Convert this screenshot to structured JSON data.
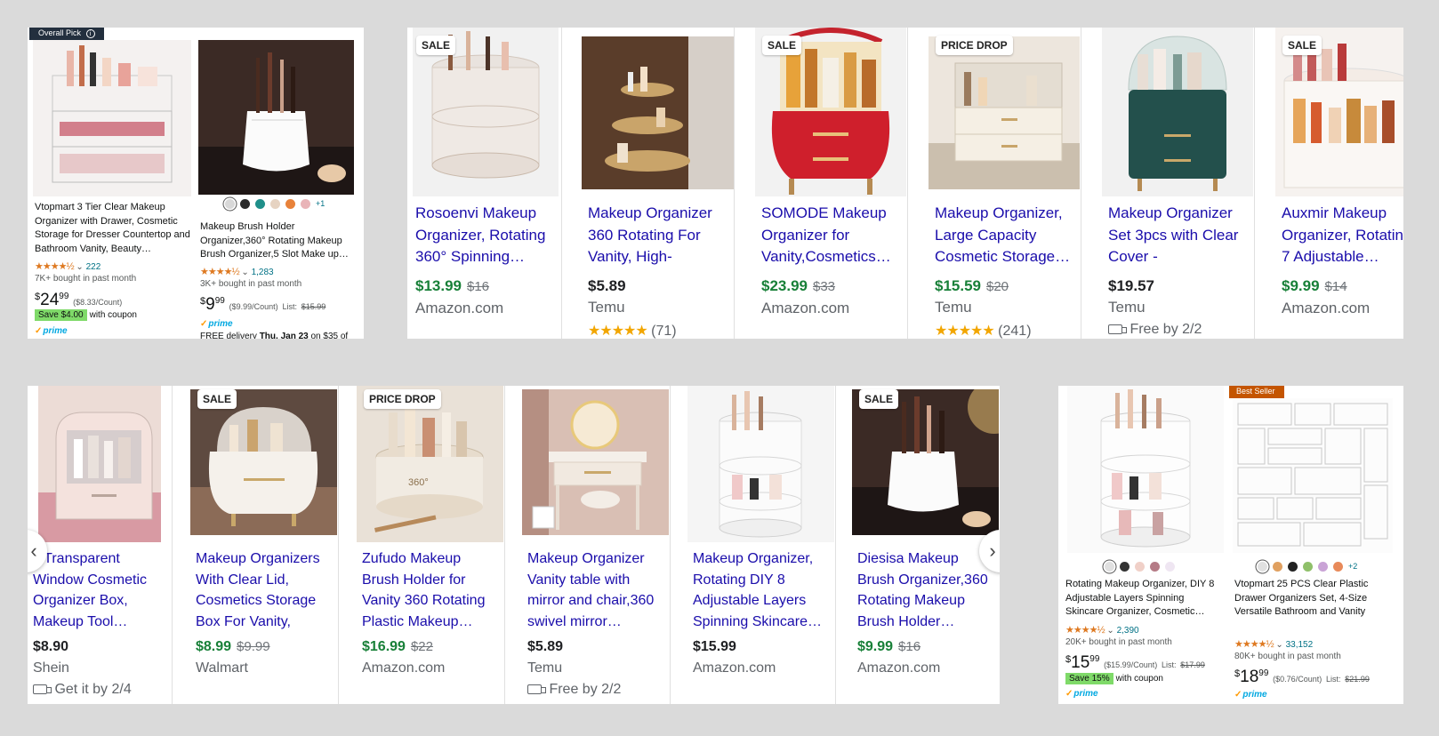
{
  "top_left_amazon": {
    "items": [
      {
        "ribbon": "Overall Pick",
        "info_icon": "i",
        "title": "Vtopmart 3 Tier Clear Makeup Organizer with Drawer, Cosmetic Storage for Dresser Countertop and Bathroom Vanity, Beauty…",
        "rating_count": "222",
        "bought": "7K+ bought in past month",
        "price_symbol": "$",
        "price_whole": "24",
        "price_frac": "99",
        "unit": "($8.33/Count)",
        "coupon_tag": "Save $4.00",
        "coupon_text": "with coupon",
        "prime": "prime"
      },
      {
        "title": "Makeup Brush Holder Organizer,360° Rotating Makeup Brush Organizer,5 Slot Make up…",
        "rating_count": "1,283",
        "bought": "3K+ bought in past month",
        "price_symbol": "$",
        "price_whole": "9",
        "price_frac": "99",
        "unit": "($9.99/Count)",
        "list_label": "List:",
        "list_price": "$15.99",
        "prime": "prime",
        "delivery_prefix": "FREE delivery",
        "delivery_date": "Thu, Jan 23",
        "delivery_suffix": "on $35 of",
        "more_swatches": "+1",
        "swatch_colors": [
          "#d8d8d8",
          "#2b2b2b",
          "#1f8f8a",
          "#e6d3c2",
          "#e8823a",
          "#e9b4b8"
        ]
      }
    ]
  },
  "top_google": {
    "items": [
      {
        "badge": "SALE",
        "title": "Rosoenvi Makeup Organizer, Rotating 360° Spinning…",
        "price": "$13.99",
        "old_price": "$16",
        "merchant": "Amazon.com"
      },
      {
        "badge": "",
        "title": "Makeup Organizer 360 Rotating For Vanity, High-Capaci…",
        "price": "$5.89",
        "merchant": "Temu",
        "stars": "★★★★★",
        "reviews": "(71)"
      },
      {
        "badge": "SALE",
        "title": "SOMODE Makeup Organizer for Vanity,Cosmetics…",
        "price": "$23.99",
        "old_price": "$33",
        "merchant": "Amazon.com"
      },
      {
        "badge": "PRICE DROP",
        "title": "Makeup Organizer, Large Capacity Cosmetic Storage…",
        "price": "$15.59",
        "old_price": "$20",
        "merchant": "Temu",
        "stars": "★★★★★",
        "reviews": "(241)"
      },
      {
        "badge": "",
        "title": "Makeup Organizer Set 3pcs with Clear Cover - Waterproof…",
        "price": "$19.57",
        "merchant": "Temu",
        "shipping": "Free by 2/2"
      },
      {
        "badge": "SALE",
        "title": "Auxmir Makeup Organizer, Rotating DIY 7 Adjustable…",
        "price": "$9.99",
        "old_price": "$14",
        "merchant": "Amazon.com"
      }
    ]
  },
  "bottom_google": {
    "prev_icon": "‹",
    "next_icon": "›",
    "items": [
      {
        "badge": "",
        "title": "c Transparent Window Cosmetic Organizer Box, Makeup Tool…",
        "price": "$8.90",
        "merchant": "Shein",
        "shipping": "Get it by 2/4"
      },
      {
        "badge": "SALE",
        "title": "Makeup Organizers With Clear Lid, Cosmetics Storage Box For Vanity, Mak…",
        "price": "$8.99",
        "old_price": "$9.99",
        "merchant": "Walmart"
      },
      {
        "badge": "PRICE DROP",
        "title": "Zufudo Makeup Brush Holder for Vanity 360 Rotating Plastic Makeup…",
        "price": "$16.99",
        "old_price": "$22",
        "merchant": "Amazon.com"
      },
      {
        "badge": "",
        "title": "Makeup Organizer Vanity table with mirror and chair,360 swivel mirror…",
        "price": "$5.89",
        "merchant": "Temu",
        "shipping": "Free by 2/2"
      },
      {
        "badge": "",
        "title": "Makeup Organizer, Rotating DIY 8 Adjustable Layers Spinning Skincare…",
        "price": "$15.99",
        "merchant": "Amazon.com"
      },
      {
        "badge": "SALE",
        "title": "Diesisa Makeup Brush Organizer,360 Rotating Makeup Brush Holder…",
        "price": "$9.99",
        "old_price": "$16",
        "merchant": "Amazon.com"
      }
    ]
  },
  "bottom_right_amazon": {
    "items": [
      {
        "title": "Rotating Makeup Organizer, DIY 8 Adjustable Layers Spinning Skincare Organizer, Cosmetic…",
        "rating_count": "2,390",
        "bought": "20K+ bought in past month",
        "price_symbol": "$",
        "price_whole": "15",
        "price_frac": "99",
        "unit": "($15.99/Count)",
        "list_label": "List:",
        "list_price": "$17.99",
        "coupon_tag": "Save 15%",
        "coupon_text": "with coupon",
        "prime": "prime",
        "swatch_colors": [
          "#e0e0e0",
          "#333333",
          "#f0d0c8",
          "#b57b86",
          "#efe6f2"
        ]
      },
      {
        "ribbon": "Best Seller",
        "title": "Vtopmart 25 PCS Clear Plastic Drawer Organizers Set, 4-Size Versatile Bathroom and Vanity Drawer Organizer Trays, Storage…",
        "rating_count": "33,152",
        "bought": "80K+ bought in past month",
        "price_symbol": "$",
        "price_whole": "18",
        "price_frac": "99",
        "unit": "($0.76/Count)",
        "list_label": "List:",
        "list_price": "$21.99",
        "prime": "prime",
        "more_swatches": "+2",
        "swatch_colors": [
          "#e0e0e0",
          "#e0a060",
          "#222222",
          "#8fc06a",
          "#c9a3d6",
          "#e88a5a"
        ]
      }
    ]
  },
  "colors": {
    "link_blue": "#1a0dab",
    "price_green": "#188038",
    "amazon_link": "#007185",
    "amazon_star": "#de7921",
    "google_star": "#f2a600"
  }
}
